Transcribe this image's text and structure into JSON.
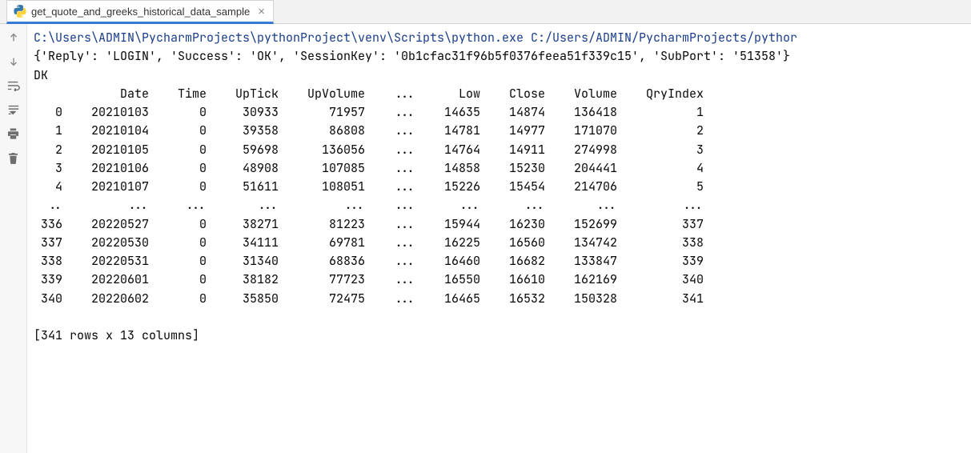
{
  "tab": {
    "label": "get_quote_and_greeks_historical_data_sample",
    "close_glyph": "×"
  },
  "console": {
    "exec_path": "C:\\Users\\ADMIN\\PycharmProjects\\pythonProject\\venv\\Scripts\\python.exe C:/Users/ADMIN/PycharmProjects/pythor",
    "login_line": "{'Reply': 'LOGIN', 'Success': 'OK', 'SessionKey': '0b1cfac31f96b5f0376feea51f339c15', 'SubPort': '51358'}",
    "dk_line": "DK",
    "columns": [
      "",
      "Date",
      "Time",
      "UpTick",
      "UpVolume",
      "...",
      "Low",
      "Close",
      "Volume",
      "QryIndex"
    ],
    "rows": [
      {
        "idx": "0",
        "Date": "20210103",
        "Time": "0",
        "UpTick": "30933",
        "UpVolume": "71957",
        "Low": "14635",
        "Close": "14874",
        "Volume": "136418",
        "QryIndex": "1"
      },
      {
        "idx": "1",
        "Date": "20210104",
        "Time": "0",
        "UpTick": "39358",
        "UpVolume": "86808",
        "Low": "14781",
        "Close": "14977",
        "Volume": "171070",
        "QryIndex": "2"
      },
      {
        "idx": "2",
        "Date": "20210105",
        "Time": "0",
        "UpTick": "59698",
        "UpVolume": "136056",
        "Low": "14764",
        "Close": "14911",
        "Volume": "274998",
        "QryIndex": "3"
      },
      {
        "idx": "3",
        "Date": "20210106",
        "Time": "0",
        "UpTick": "48908",
        "UpVolume": "107085",
        "Low": "14858",
        "Close": "15230",
        "Volume": "204441",
        "QryIndex": "4"
      },
      {
        "idx": "4",
        "Date": "20210107",
        "Time": "0",
        "UpTick": "51611",
        "UpVolume": "108051",
        "Low": "15226",
        "Close": "15454",
        "Volume": "214706",
        "QryIndex": "5"
      }
    ],
    "rows_tail": [
      {
        "idx": "336",
        "Date": "20220527",
        "Time": "0",
        "UpTick": "38271",
        "UpVolume": "81223",
        "Low": "15944",
        "Close": "16230",
        "Volume": "152699",
        "QryIndex": "337"
      },
      {
        "idx": "337",
        "Date": "20220530",
        "Time": "0",
        "UpTick": "34111",
        "UpVolume": "69781",
        "Low": "16225",
        "Close": "16560",
        "Volume": "134742",
        "QryIndex": "338"
      },
      {
        "idx": "338",
        "Date": "20220531",
        "Time": "0",
        "UpTick": "31340",
        "UpVolume": "68836",
        "Low": "16460",
        "Close": "16682",
        "Volume": "133847",
        "QryIndex": "339"
      },
      {
        "idx": "339",
        "Date": "20220601",
        "Time": "0",
        "UpTick": "38182",
        "UpVolume": "77723",
        "Low": "16550",
        "Close": "16610",
        "Volume": "162169",
        "QryIndex": "340"
      },
      {
        "idx": "340",
        "Date": "20220602",
        "Time": "0",
        "UpTick": "35850",
        "UpVolume": "72475",
        "Low": "16465",
        "Close": "16532",
        "Volume": "150328",
        "QryIndex": "341"
      }
    ],
    "ellipsis_cells": [
      "..",
      "...",
      "...",
      "...",
      "...",
      "...",
      "...",
      "...",
      "...",
      "..."
    ],
    "summary": "[341 rows x 13 columns]"
  },
  "widths": {
    "idx": 4,
    "Date": 10,
    "Time": 6,
    "UpTick": 8,
    "UpVolume": 10,
    "sep": 5,
    "Low": 7,
    "Close": 7,
    "Volume": 8,
    "QryIndex": 10
  }
}
